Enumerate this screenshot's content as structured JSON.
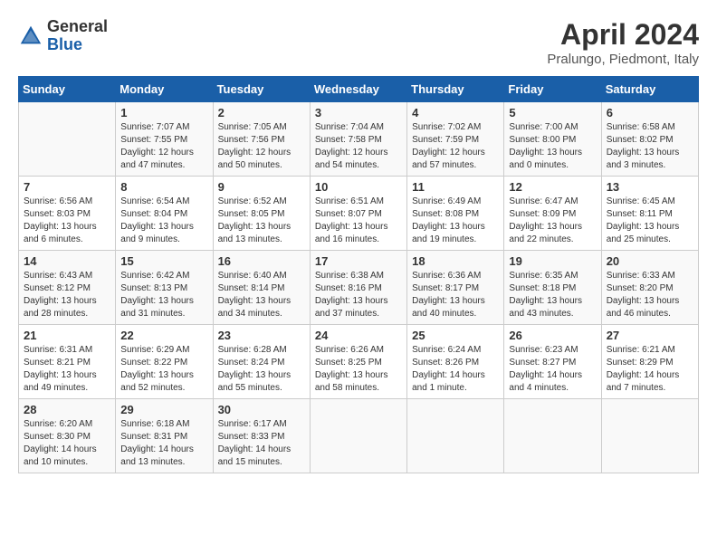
{
  "header": {
    "logo_general": "General",
    "logo_blue": "Blue",
    "month_title": "April 2024",
    "location": "Pralungo, Piedmont, Italy"
  },
  "calendar": {
    "days_of_week": [
      "Sunday",
      "Monday",
      "Tuesday",
      "Wednesday",
      "Thursday",
      "Friday",
      "Saturday"
    ],
    "weeks": [
      [
        {
          "day": "",
          "info": ""
        },
        {
          "day": "1",
          "info": "Sunrise: 7:07 AM\nSunset: 7:55 PM\nDaylight: 12 hours\nand 47 minutes."
        },
        {
          "day": "2",
          "info": "Sunrise: 7:05 AM\nSunset: 7:56 PM\nDaylight: 12 hours\nand 50 minutes."
        },
        {
          "day": "3",
          "info": "Sunrise: 7:04 AM\nSunset: 7:58 PM\nDaylight: 12 hours\nand 54 minutes."
        },
        {
          "day": "4",
          "info": "Sunrise: 7:02 AM\nSunset: 7:59 PM\nDaylight: 12 hours\nand 57 minutes."
        },
        {
          "day": "5",
          "info": "Sunrise: 7:00 AM\nSunset: 8:00 PM\nDaylight: 13 hours\nand 0 minutes."
        },
        {
          "day": "6",
          "info": "Sunrise: 6:58 AM\nSunset: 8:02 PM\nDaylight: 13 hours\nand 3 minutes."
        }
      ],
      [
        {
          "day": "7",
          "info": "Sunrise: 6:56 AM\nSunset: 8:03 PM\nDaylight: 13 hours\nand 6 minutes."
        },
        {
          "day": "8",
          "info": "Sunrise: 6:54 AM\nSunset: 8:04 PM\nDaylight: 13 hours\nand 9 minutes."
        },
        {
          "day": "9",
          "info": "Sunrise: 6:52 AM\nSunset: 8:05 PM\nDaylight: 13 hours\nand 13 minutes."
        },
        {
          "day": "10",
          "info": "Sunrise: 6:51 AM\nSunset: 8:07 PM\nDaylight: 13 hours\nand 16 minutes."
        },
        {
          "day": "11",
          "info": "Sunrise: 6:49 AM\nSunset: 8:08 PM\nDaylight: 13 hours\nand 19 minutes."
        },
        {
          "day": "12",
          "info": "Sunrise: 6:47 AM\nSunset: 8:09 PM\nDaylight: 13 hours\nand 22 minutes."
        },
        {
          "day": "13",
          "info": "Sunrise: 6:45 AM\nSunset: 8:11 PM\nDaylight: 13 hours\nand 25 minutes."
        }
      ],
      [
        {
          "day": "14",
          "info": "Sunrise: 6:43 AM\nSunset: 8:12 PM\nDaylight: 13 hours\nand 28 minutes."
        },
        {
          "day": "15",
          "info": "Sunrise: 6:42 AM\nSunset: 8:13 PM\nDaylight: 13 hours\nand 31 minutes."
        },
        {
          "day": "16",
          "info": "Sunrise: 6:40 AM\nSunset: 8:14 PM\nDaylight: 13 hours\nand 34 minutes."
        },
        {
          "day": "17",
          "info": "Sunrise: 6:38 AM\nSunset: 8:16 PM\nDaylight: 13 hours\nand 37 minutes."
        },
        {
          "day": "18",
          "info": "Sunrise: 6:36 AM\nSunset: 8:17 PM\nDaylight: 13 hours\nand 40 minutes."
        },
        {
          "day": "19",
          "info": "Sunrise: 6:35 AM\nSunset: 8:18 PM\nDaylight: 13 hours\nand 43 minutes."
        },
        {
          "day": "20",
          "info": "Sunrise: 6:33 AM\nSunset: 8:20 PM\nDaylight: 13 hours\nand 46 minutes."
        }
      ],
      [
        {
          "day": "21",
          "info": "Sunrise: 6:31 AM\nSunset: 8:21 PM\nDaylight: 13 hours\nand 49 minutes."
        },
        {
          "day": "22",
          "info": "Sunrise: 6:29 AM\nSunset: 8:22 PM\nDaylight: 13 hours\nand 52 minutes."
        },
        {
          "day": "23",
          "info": "Sunrise: 6:28 AM\nSunset: 8:24 PM\nDaylight: 13 hours\nand 55 minutes."
        },
        {
          "day": "24",
          "info": "Sunrise: 6:26 AM\nSunset: 8:25 PM\nDaylight: 13 hours\nand 58 minutes."
        },
        {
          "day": "25",
          "info": "Sunrise: 6:24 AM\nSunset: 8:26 PM\nDaylight: 14 hours\nand 1 minute."
        },
        {
          "day": "26",
          "info": "Sunrise: 6:23 AM\nSunset: 8:27 PM\nDaylight: 14 hours\nand 4 minutes."
        },
        {
          "day": "27",
          "info": "Sunrise: 6:21 AM\nSunset: 8:29 PM\nDaylight: 14 hours\nand 7 minutes."
        }
      ],
      [
        {
          "day": "28",
          "info": "Sunrise: 6:20 AM\nSunset: 8:30 PM\nDaylight: 14 hours\nand 10 minutes."
        },
        {
          "day": "29",
          "info": "Sunrise: 6:18 AM\nSunset: 8:31 PM\nDaylight: 14 hours\nand 13 minutes."
        },
        {
          "day": "30",
          "info": "Sunrise: 6:17 AM\nSunset: 8:33 PM\nDaylight: 14 hours\nand 15 minutes."
        },
        {
          "day": "",
          "info": ""
        },
        {
          "day": "",
          "info": ""
        },
        {
          "day": "",
          "info": ""
        },
        {
          "day": "",
          "info": ""
        }
      ]
    ]
  }
}
